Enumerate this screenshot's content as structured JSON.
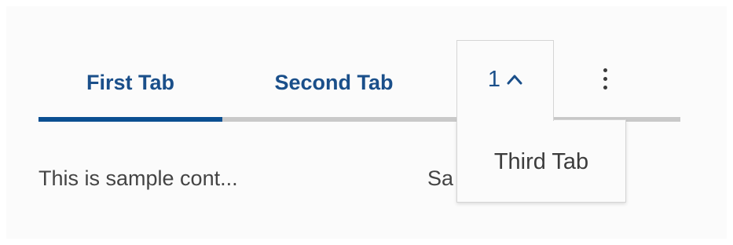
{
  "tabs": [
    {
      "label": "First Tab",
      "active": true
    },
    {
      "label": "Second Tab",
      "active": false
    }
  ],
  "overflow": {
    "count": "1",
    "icon": "chevron-up-icon",
    "items": [
      {
        "label": "Third Tab"
      }
    ]
  },
  "more_menu": {
    "icon": "more-vertical-icon"
  },
  "content": {
    "text_1": "This is sample cont...",
    "text_2": "Sa"
  },
  "colors": {
    "accent": "#0b4f91",
    "tab_text": "#1a4f8a",
    "track": "#c9c9c9",
    "body_text": "#444444"
  }
}
